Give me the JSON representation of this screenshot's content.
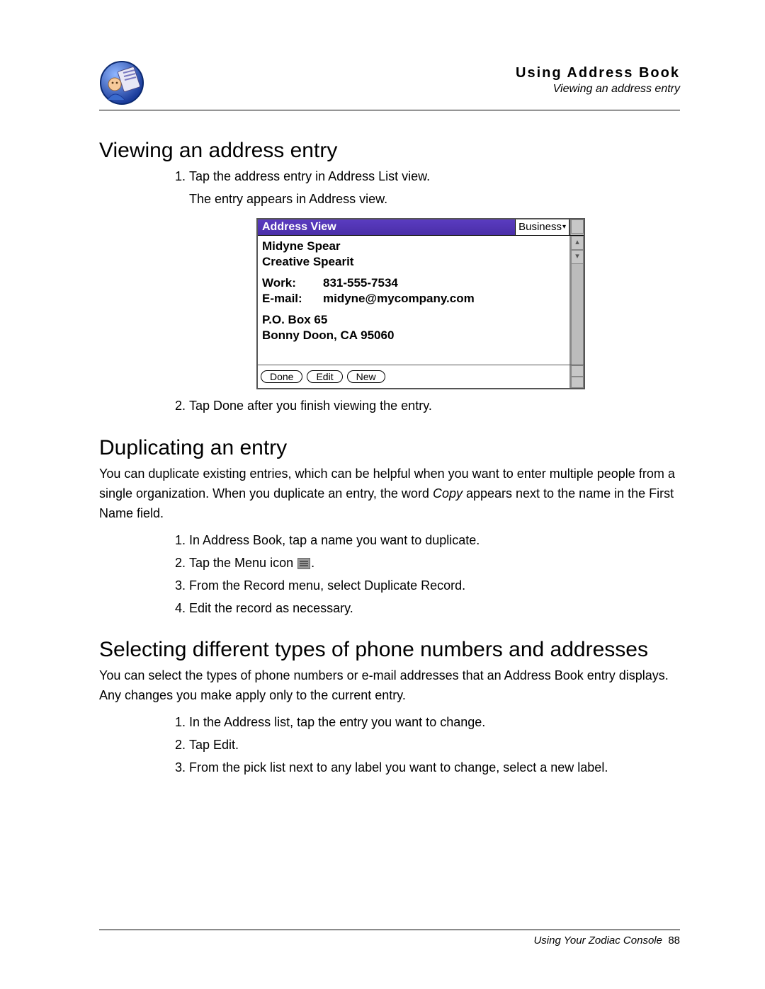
{
  "header": {
    "title": "Using Address Book",
    "subtitle": "Viewing an address entry"
  },
  "sections": {
    "viewing": {
      "heading": "Viewing an address entry",
      "step1": "Tap the address entry in Address List view.",
      "step1_result": "The entry appears in Address view.",
      "step2": "Tap Done after you finish viewing the entry."
    },
    "duplicating": {
      "heading": "Duplicating an entry",
      "intro_a": "You can duplicate existing entries, which can be helpful when you want to enter multiple people from a single organization. When you duplicate an entry, the word ",
      "intro_copy": "Copy",
      "intro_b": " appears next to the name in the First Name field.",
      "step1": "In Address Book, tap a name you want to duplicate.",
      "step2_a": "Tap the Menu icon ",
      "step2_b": ".",
      "step3": "From the Record menu, select Duplicate Record.",
      "step4": "Edit the record as necessary."
    },
    "selecting": {
      "heading": "Selecting different types of phone numbers and addresses",
      "intro": "You can select the types of phone numbers or e-mail addresses that an Address Book entry displays. Any changes you make apply only to the current entry.",
      "step1": "In the Address list, tap the entry you want to change.",
      "step2": "Tap Edit.",
      "step3": "From the pick list next to any label you want to change, select a new label."
    }
  },
  "pda": {
    "title": "Address View",
    "category": "Business",
    "name": "Midyne Spear",
    "company": "Creative Spearit",
    "work_label": "Work:",
    "work_value": "831-555-7534",
    "email_label": "E-mail:",
    "email_value": "midyne@mycompany.com",
    "addr1": "P.O. Box 65",
    "addr2": "Bonny Doon, CA  95060",
    "btn_done": "Done",
    "btn_edit": "Edit",
    "btn_new": "New"
  },
  "footer": {
    "text": "Using Your Zodiac Console",
    "page": "88"
  }
}
